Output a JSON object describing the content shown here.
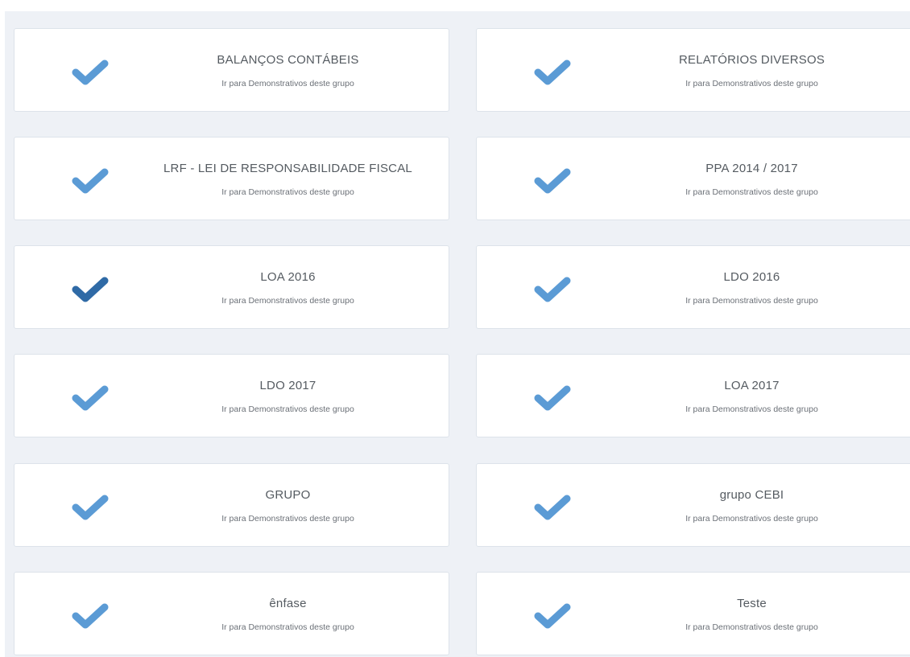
{
  "colors": {
    "check": "#5b9bd5",
    "check_active": "#2f6aa6",
    "background": "#eef1f6"
  },
  "link_text": "Ir para Demonstrativos deste grupo",
  "groups": [
    {
      "title": "BALANÇOS CONTÁBEIS",
      "icon": "check-icon",
      "active": false
    },
    {
      "title": "RELATÓRIOS DIVERSOS",
      "icon": "check-icon",
      "active": false
    },
    {
      "title": "LRF - LEI DE RESPONSABILIDADE FISCAL",
      "icon": "check-icon",
      "active": false
    },
    {
      "title": "PPA 2014 / 2017",
      "icon": "check-icon",
      "active": false
    },
    {
      "title": "LOA 2016",
      "icon": "check-icon",
      "active": true
    },
    {
      "title": "LDO 2016",
      "icon": "check-icon",
      "active": false
    },
    {
      "title": "LDO 2017",
      "icon": "check-icon",
      "active": false
    },
    {
      "title": "LOA 2017",
      "icon": "check-icon",
      "active": false
    },
    {
      "title": "GRUPO",
      "icon": "check-icon",
      "active": false
    },
    {
      "title": "grupo CEBI",
      "icon": "check-icon",
      "active": false
    },
    {
      "title": "ênfase",
      "icon": "check-icon",
      "active": false
    },
    {
      "title": "Teste",
      "icon": "check-icon",
      "active": false
    }
  ]
}
